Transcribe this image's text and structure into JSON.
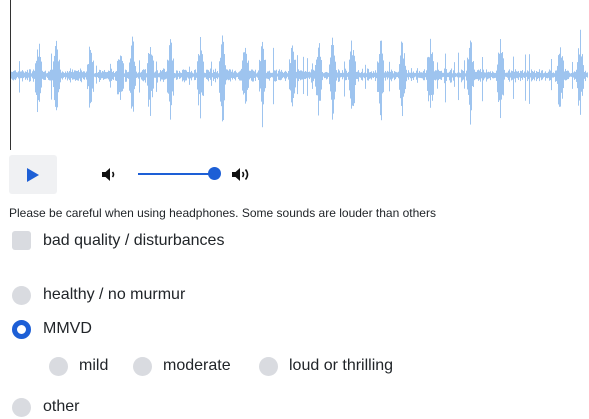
{
  "player": {
    "play_icon": "play-icon",
    "volume_low_icon": "volume-low-icon",
    "volume_high_icon": "volume-high-icon",
    "volume_level": 1.0,
    "accent_color": "#1d5fd6",
    "waveform_color": "#9ec4ef"
  },
  "warning_text": "Please be careful when using headphones. Some sounds are louder than others",
  "quality_checkbox": {
    "label": "bad quality / disturbances",
    "checked": false
  },
  "diagnosis": {
    "healthy": {
      "label": "healthy / no murmur",
      "checked": false
    },
    "mmvd": {
      "label": "MMVD",
      "checked": true
    },
    "severity": [
      {
        "label": "mild",
        "checked": false
      },
      {
        "label": "moderate",
        "checked": false
      },
      {
        "label": "loud or thrilling",
        "checked": false
      }
    ],
    "other": {
      "label": "other",
      "checked": false
    }
  }
}
